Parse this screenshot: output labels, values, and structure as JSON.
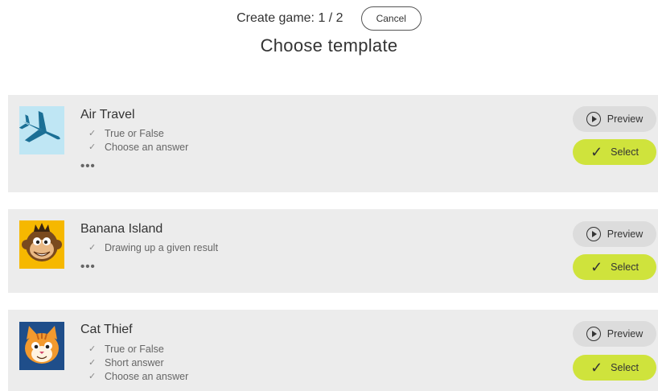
{
  "header": {
    "step_label": "Create game: 1 / 2",
    "cancel_label": "Cancel",
    "title": "Choose template"
  },
  "icons": {
    "feature_check": "check-icon",
    "preview": "play-circle-icon",
    "select": "check-icon"
  },
  "colors": {
    "card_bg": "#ececec",
    "preview_bg": "#dcdcdc",
    "select_bg": "#cfe33c"
  },
  "templates": [
    {
      "name": "Air Travel",
      "thumbnail": "airplane-icon",
      "features": [
        "True or False",
        "Choose an answer"
      ],
      "has_more": true,
      "more_label": "•••",
      "preview_label": "Preview",
      "select_label": "Select"
    },
    {
      "name": "Banana Island",
      "thumbnail": "monkey-icon",
      "features": [
        "Drawing up a given result"
      ],
      "has_more": true,
      "more_label": "•••",
      "preview_label": "Preview",
      "select_label": "Select"
    },
    {
      "name": "Cat Thief",
      "thumbnail": "cat-icon",
      "features": [
        "True or False",
        "Short answer",
        "Choose an answer"
      ],
      "has_more": false,
      "preview_label": "Preview",
      "select_label": "Select"
    }
  ]
}
